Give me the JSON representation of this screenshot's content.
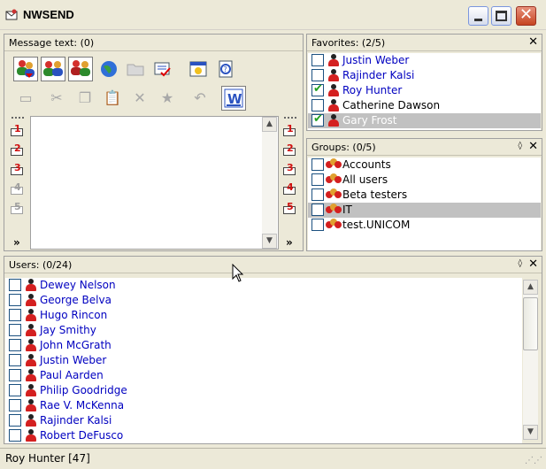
{
  "window": {
    "title": "NWSEND"
  },
  "message": {
    "title": "Message text: (0)",
    "text": "",
    "more_label": "»",
    "numbers": [
      "1",
      "2",
      "3",
      "4",
      "5"
    ]
  },
  "favorites": {
    "title": "Favorites: (2/5)",
    "close_glyph": "✕",
    "items": [
      {
        "name": "Justin Weber",
        "checked": false,
        "blue": true
      },
      {
        "name": "Rajinder Kalsi",
        "checked": false,
        "blue": true
      },
      {
        "name": "Roy Hunter",
        "checked": true,
        "blue": true
      },
      {
        "name": "Catherine Dawson",
        "checked": false,
        "blue": false
      },
      {
        "name": "Gary Frost",
        "checked": true,
        "blue": false,
        "selected": true
      }
    ]
  },
  "groups": {
    "title": "Groups: (0/5)",
    "restore_glyph": "◊",
    "close_glyph": "✕",
    "items": [
      {
        "name": "Accounts"
      },
      {
        "name": "All users"
      },
      {
        "name": "Beta testers"
      },
      {
        "name": "IT",
        "selected": true
      },
      {
        "name": "test.UNICOM"
      }
    ]
  },
  "users": {
    "title": "Users: (0/24)",
    "restore_glyph": "◊",
    "close_glyph": "✕",
    "items": [
      "Dewey Nelson",
      "George Belva",
      "Hugo Rincon",
      "Jay Smithy",
      "John McGrath",
      "Justin Weber",
      "Paul Aarden",
      "Philip Goodridge",
      "Rae V. McKenna",
      "Rajinder Kalsi",
      "Robert DeFusco"
    ]
  },
  "status": {
    "text": "Roy Hunter [47]"
  },
  "colors": {
    "link": "#0000c0",
    "person_body": "#d42020",
    "check": "#21a121",
    "selection": "#c1c1c1"
  }
}
